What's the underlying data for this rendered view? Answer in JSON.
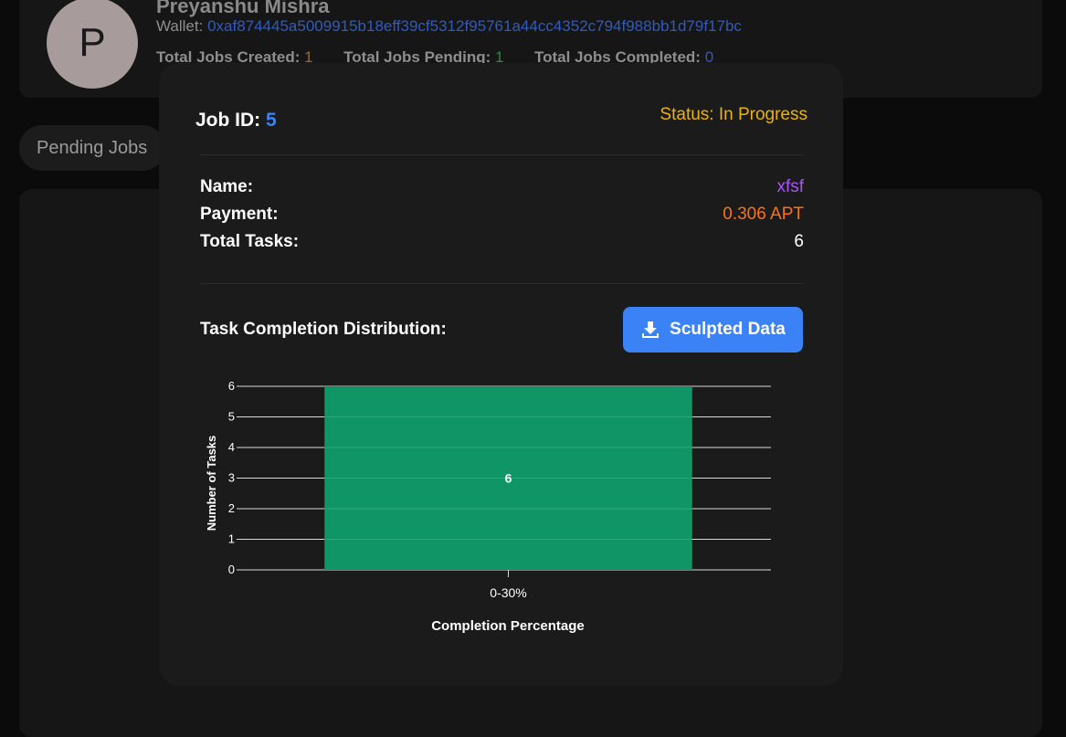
{
  "profile": {
    "avatar_letter": "P",
    "name": "Preyanshu Mishra",
    "wallet_label": "Wallet:",
    "wallet_address": "0xaf874445a5009915b18eff39cf5312f95761a44cc4352c794f988bb1d79f17bc",
    "stats": {
      "created_label": "Total Jobs Created:",
      "created_value": "1",
      "pending_label": "Total Jobs Pending:",
      "pending_value": "1",
      "completed_label": "Total Jobs Completed:",
      "completed_value": "0"
    }
  },
  "tabs": {
    "pending_label": "Pending Jobs"
  },
  "modal": {
    "job_id_label": "Job ID:",
    "job_id_value": "5",
    "status_label": "Status: In Progress",
    "rows": {
      "name_label": "Name:",
      "name_value": "xfsf",
      "payment_label": "Payment:",
      "payment_value": "0.306 APT",
      "tasks_label": "Total Tasks:",
      "tasks_value": "6"
    },
    "distribution_title": "Task Completion Distribution:",
    "download_label": "Sculpted Data"
  },
  "colors": {
    "accent_blue": "#3b82f6",
    "status_yellow": "#eab308",
    "name_purple": "#a855f7",
    "payment_orange": "#f97316",
    "bar_green": "#109566"
  },
  "icons": {
    "download": "download-icon"
  },
  "chart_data": {
    "type": "bar",
    "categories": [
      "0-30%"
    ],
    "values": [
      6
    ],
    "data_labels": [
      "6"
    ],
    "xlabel": "Completion Percentage",
    "ylabel": "Number of Tasks",
    "ylim": [
      0,
      6
    ],
    "yticks": [
      0,
      1,
      2,
      3,
      4,
      5,
      6
    ],
    "grid": true,
    "legend": "none"
  }
}
